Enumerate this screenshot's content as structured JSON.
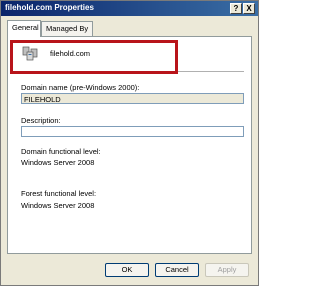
{
  "window": {
    "title": "filehold.com Properties",
    "help_button": "?",
    "close_button": "X"
  },
  "tabs": [
    {
      "label": "General",
      "active": true
    },
    {
      "label": "Managed By",
      "active": false
    }
  ],
  "general": {
    "domain_icon": "domain-icon",
    "domain_name": "filehold.com",
    "netbios_label": "Domain name (pre-Windows 2000):",
    "netbios_value": "FILEHOLD",
    "description_label": "Description:",
    "description_value": "",
    "domain_level_label": "Domain functional level:",
    "domain_level_value": "Windows Server 2008",
    "forest_level_label": "Forest functional level:",
    "forest_level_value": "Windows Server 2008"
  },
  "buttons": {
    "ok": "OK",
    "cancel": "Cancel",
    "apply": "Apply"
  },
  "colors": {
    "highlight": "#b8141a",
    "titlebar": "#0a246a"
  }
}
